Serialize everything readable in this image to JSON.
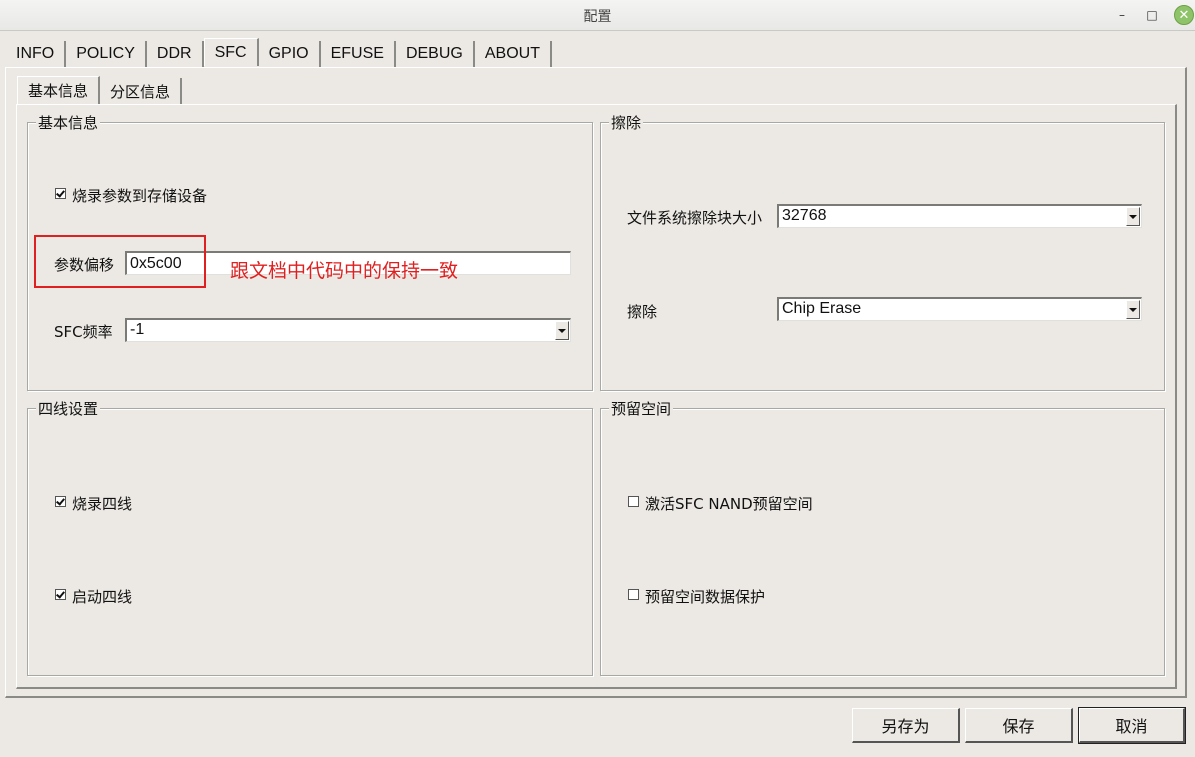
{
  "window": {
    "title": "配置",
    "minimize": "–",
    "maximize": "□",
    "close": "✕"
  },
  "tabs": [
    "INFO",
    "POLICY",
    "DDR",
    "SFC",
    "GPIO",
    "EFUSE",
    "DEBUG",
    "ABOUT"
  ],
  "active_tab": "SFC",
  "subtabs": [
    "基本信息",
    "分区信息"
  ],
  "basic": {
    "title": "基本信息",
    "burn_params_label": "烧录参数到存储设备",
    "burn_params_checked": true,
    "param_offset_label": "参数偏移",
    "param_offset_value": "0x5c00",
    "sfc_freq_label": "SFC频率",
    "sfc_freq_value": "-1"
  },
  "annotation": {
    "text": "跟文档中代码中的保持一致",
    "color": "#e02020"
  },
  "erase": {
    "title": "擦除",
    "block_size_label": "文件系统擦除块大小",
    "block_size_value": "32768",
    "erase_label": "擦除",
    "erase_value": "Chip Erase"
  },
  "quad": {
    "title": "四线设置",
    "burn_quad_label": "烧录四线",
    "burn_quad_checked": true,
    "boot_quad_label": "启动四线",
    "boot_quad_checked": true
  },
  "reserved": {
    "title": "预留空间",
    "activate_label": "激活SFC NAND预留空间",
    "activate_checked": false,
    "protect_label": "预留空间数据保护",
    "protect_checked": false
  },
  "buttons": {
    "save_as": "另存为",
    "save": "保存",
    "cancel": "取消"
  }
}
